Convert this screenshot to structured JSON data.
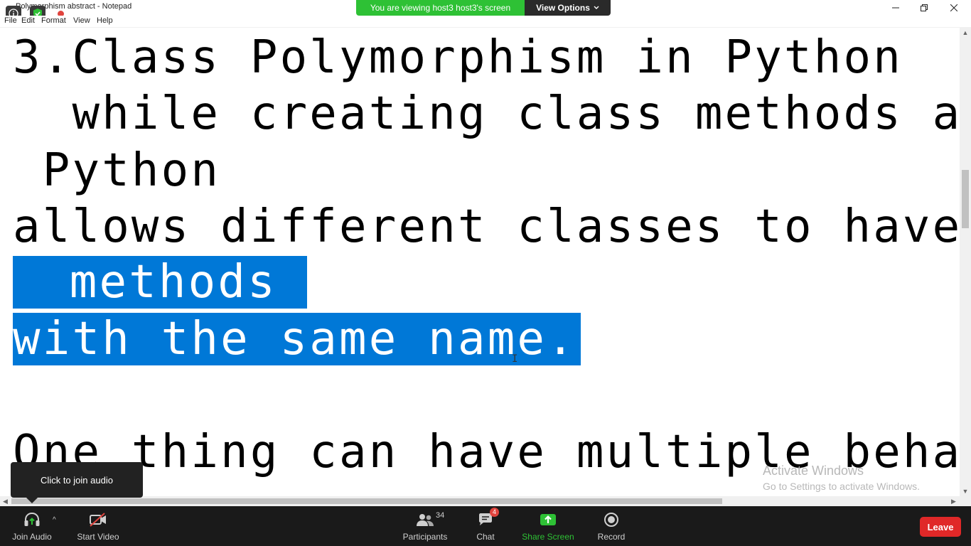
{
  "notepad": {
    "title": "Polymorphism abstract - Notepad",
    "menu": [
      "File",
      "Edit",
      "Format",
      "View",
      "Help"
    ]
  },
  "zoom_banner": {
    "status": "You are viewing host3 host3's screen",
    "view_options": "View Options"
  },
  "editor": {
    "lines": [
      "3.Class Polymorphism in Python",
      "  while creating class methods as",
      " Python",
      "allows different classes to have",
      " methods ",
      "with the same name.",
      "",
      "One thing can have multiple behavio"
    ],
    "selected_text": "methods with the same name."
  },
  "watermark": {
    "title": "Activate Windows",
    "subtitle": "Go to Settings to activate Windows."
  },
  "audio_tooltip": "Click to join audio",
  "toolbar": {
    "join_audio": "Join Audio",
    "start_video": "Start Video",
    "participants": "Participants",
    "participants_count": "34",
    "chat": "Chat",
    "chat_badge": "4",
    "share_screen": "Share Screen",
    "record": "Record",
    "leave": "Leave"
  },
  "colors": {
    "selection": "#0078d7",
    "zoom_green": "#2ec135",
    "toolbar_bg": "#1a1a1a",
    "leave_red": "#e02828"
  }
}
